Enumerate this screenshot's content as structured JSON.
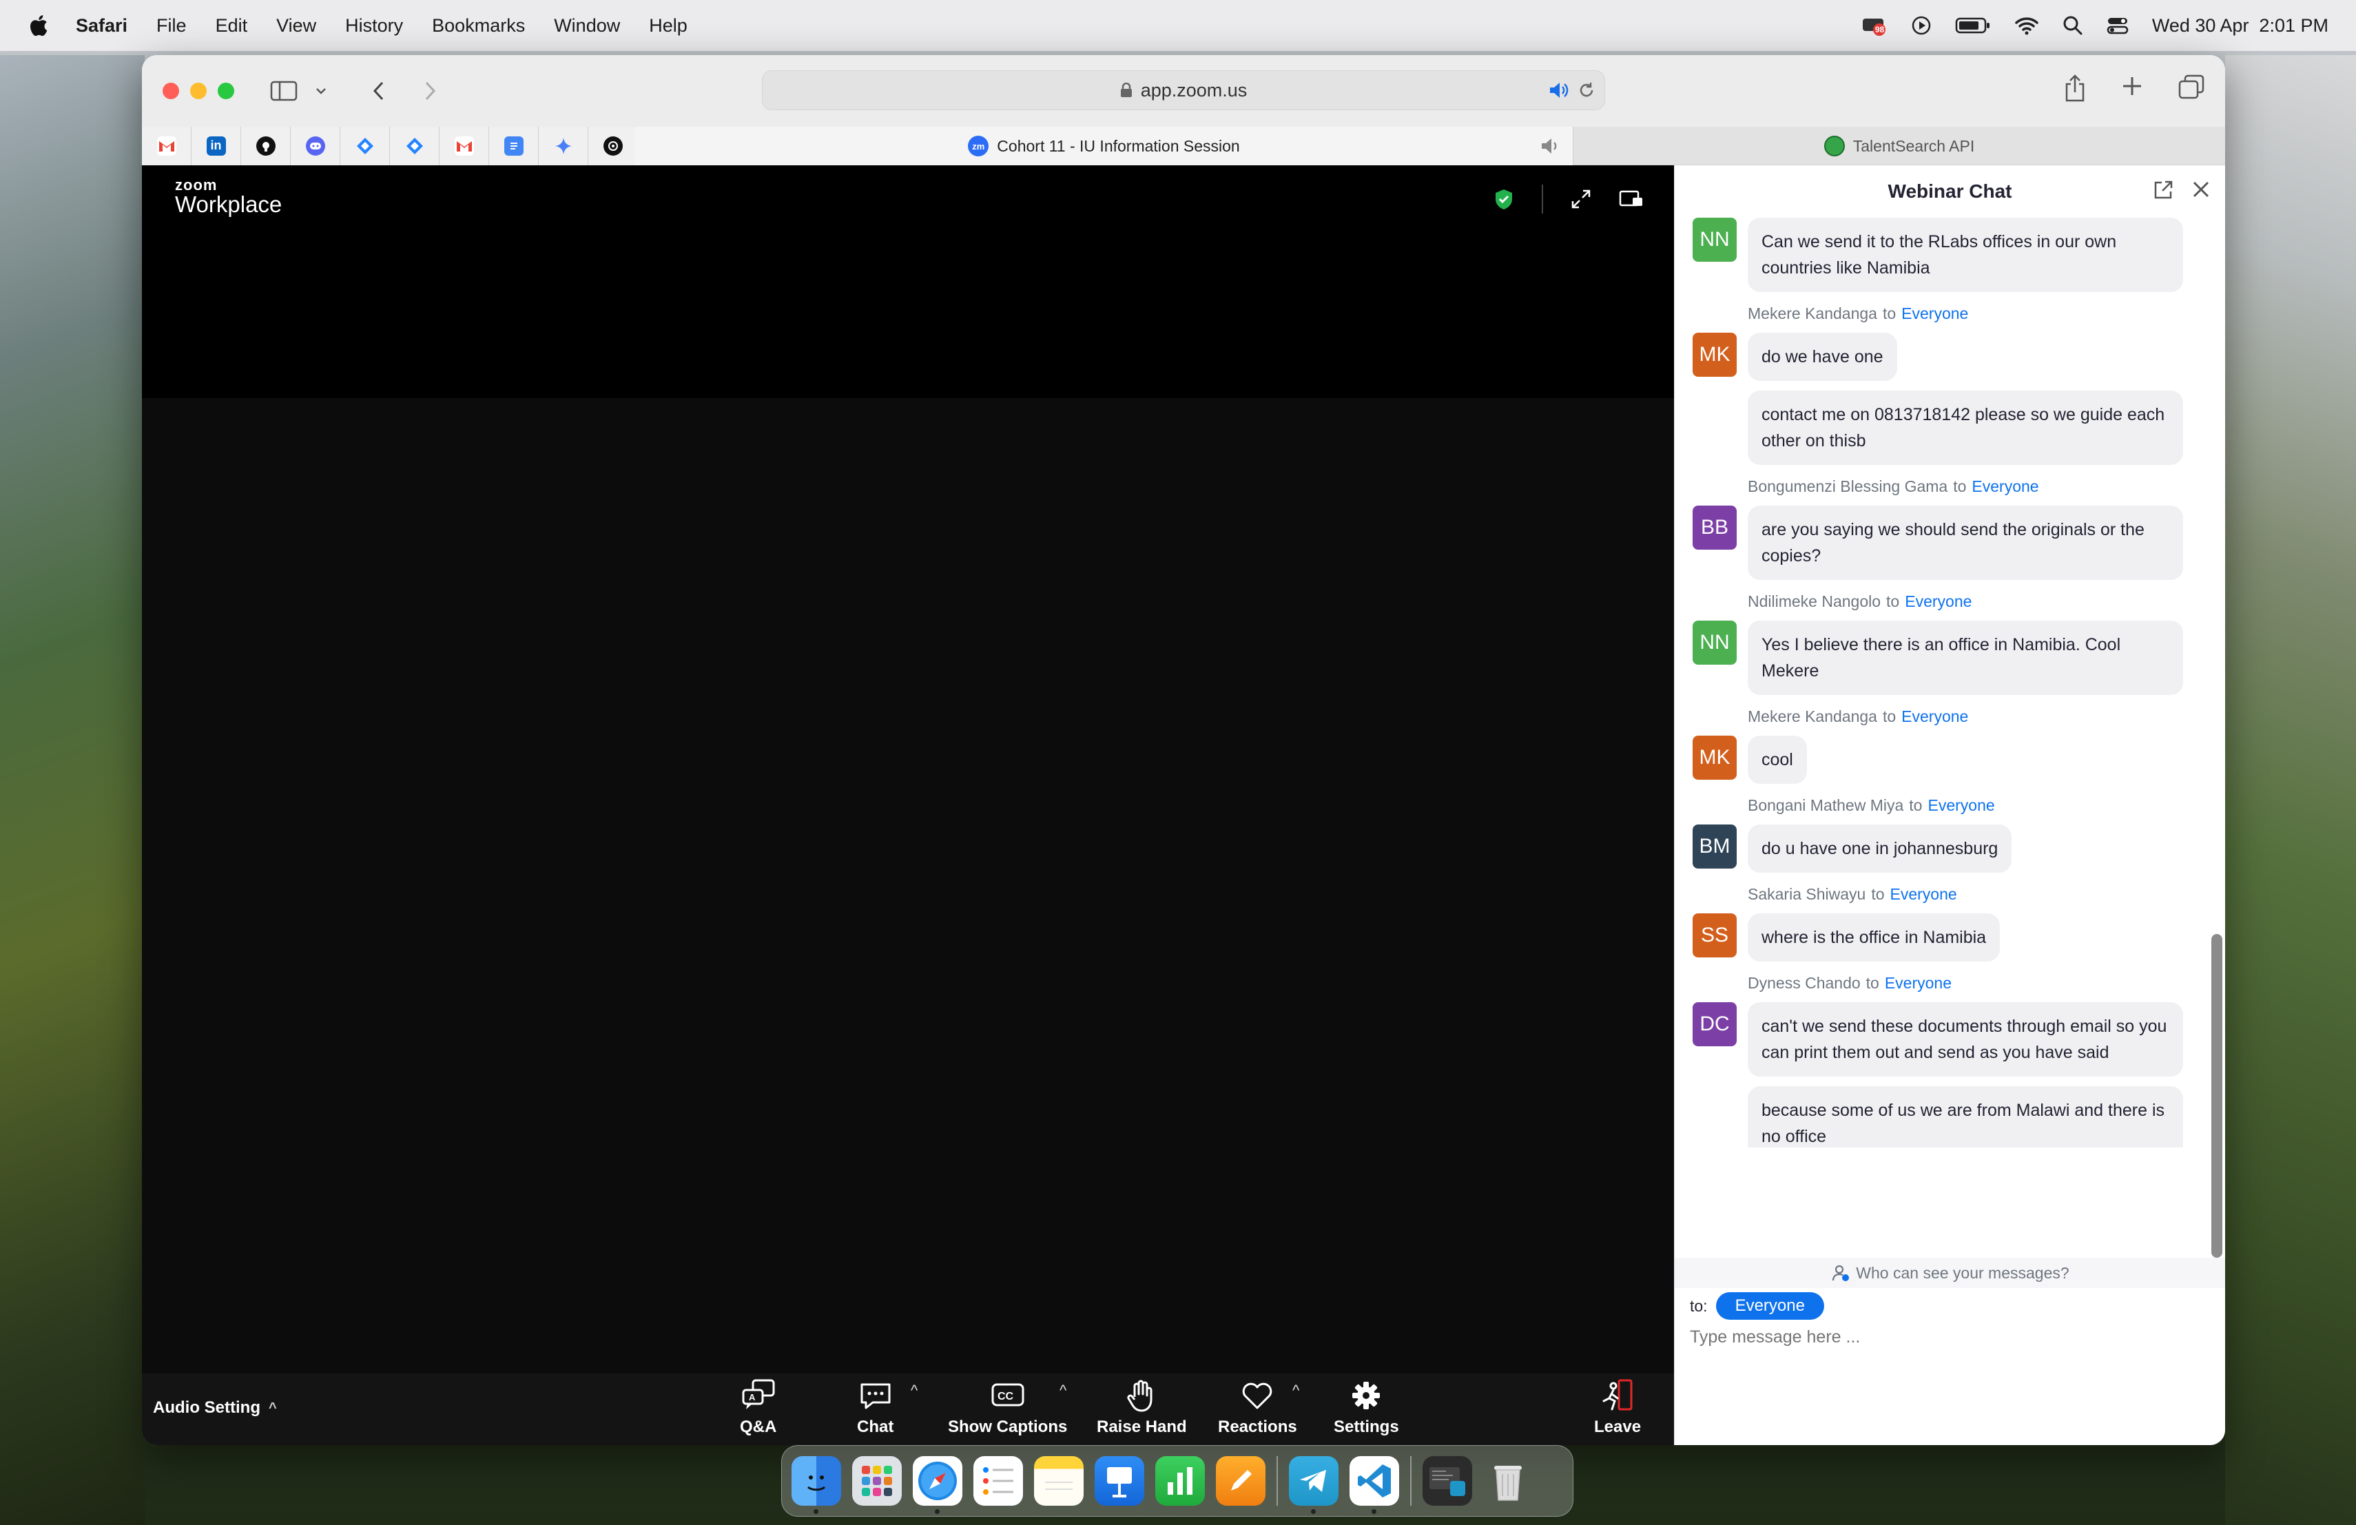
{
  "menubar": {
    "app_name": "Safari",
    "items": [
      "File",
      "Edit",
      "View",
      "History",
      "Bookmarks",
      "Window",
      "Help"
    ],
    "notification_badge": "98",
    "datetime": "Wed 30 Apr  2:01 PM"
  },
  "browser": {
    "url": "app.zoom.us",
    "tabs": {
      "active": "Cohort 11 - IU Information Session",
      "active_favicon": "zm",
      "other": "TalentSearch API"
    },
    "pinned_tabs": [
      "gmail-icon",
      "linkedin-icon",
      "github-icon",
      "discord-icon",
      "jira-icon",
      "jira-icon",
      "gmail-icon",
      "docs-icon",
      "gemini-icon",
      "chatgpt-icon"
    ]
  },
  "meeting": {
    "logo_small": "zoom",
    "logo_big": "Workplace",
    "audio_setting": "Audio Setting",
    "controls": {
      "qa": "Q&A",
      "chat": "Chat",
      "captions": "Show Captions",
      "raise_hand": "Raise Hand",
      "reactions": "Reactions",
      "settings": "Settings",
      "leave": "Leave"
    }
  },
  "chat": {
    "title": "Webinar Chat",
    "to_word": "to",
    "messages": [
      {
        "type": "bubble",
        "avatar": "NN",
        "avatar_color": "#4caf50",
        "text": "Can we send  it to the RLabs offices in our own countries like Namibia"
      },
      {
        "type": "sender",
        "name": "Mekere Kandanga",
        "target": "Everyone"
      },
      {
        "type": "bubble",
        "avatar": "MK",
        "avatar_color": "#d35f1c",
        "text": "do we have one"
      },
      {
        "type": "bubble",
        "avatar": "",
        "text": "contact me on 0813718142 please so we guide each other on thisb"
      },
      {
        "type": "sender",
        "name": "Bongumenzi Blessing Gama",
        "target": "Everyone"
      },
      {
        "type": "bubble",
        "avatar": "BB",
        "avatar_color": "#7b3fa5",
        "text": "are you saying we should send the originals or the copies?"
      },
      {
        "type": "sender",
        "name": "Ndilimeke Nangolo",
        "target": "Everyone"
      },
      {
        "type": "bubble",
        "avatar": "NN",
        "avatar_color": "#4caf50",
        "text": "Yes I believe there is an office in Namibia. Cool Mekere"
      },
      {
        "type": "sender",
        "name": "Mekere Kandanga",
        "target": "Everyone"
      },
      {
        "type": "bubble",
        "avatar": "MK",
        "avatar_color": "#d35f1c",
        "text": "cool"
      },
      {
        "type": "sender",
        "name": "Bongani Mathew Miya",
        "target": "Everyone"
      },
      {
        "type": "bubble",
        "avatar": "BM",
        "avatar_color": "#2f4456",
        "text": "do u have one in johannesburg"
      },
      {
        "type": "sender",
        "name": "Sakaria Shiwayu",
        "target": "Everyone"
      },
      {
        "type": "bubble",
        "avatar": "SS",
        "avatar_color": "#d35f1c",
        "text": "where is the office in Namibia"
      },
      {
        "type": "sender",
        "name": "Dyness Chando",
        "target": "Everyone"
      },
      {
        "type": "bubble",
        "avatar": "DC",
        "avatar_color": "#7b3fa5",
        "text": "can't we send these documents through email so you can print them out and send as you have said"
      },
      {
        "type": "bubble",
        "avatar": "",
        "text": "because some of us we are from Malawi and there is no office"
      }
    ],
    "who_can_see": "Who can see your messages?",
    "to_label": "to:",
    "to_value": "Everyone",
    "input_placeholder": "Type message here ..."
  },
  "dock": {
    "apps": [
      "finder-icon",
      "launchpad-icon",
      "safari-icon",
      "reminders-icon",
      "notes-icon",
      "keynote-icon",
      "numbers-icon",
      "pages-icon",
      "telegram-icon",
      "vscode-icon",
      "screenshot-icon",
      "trash-icon"
    ]
  }
}
